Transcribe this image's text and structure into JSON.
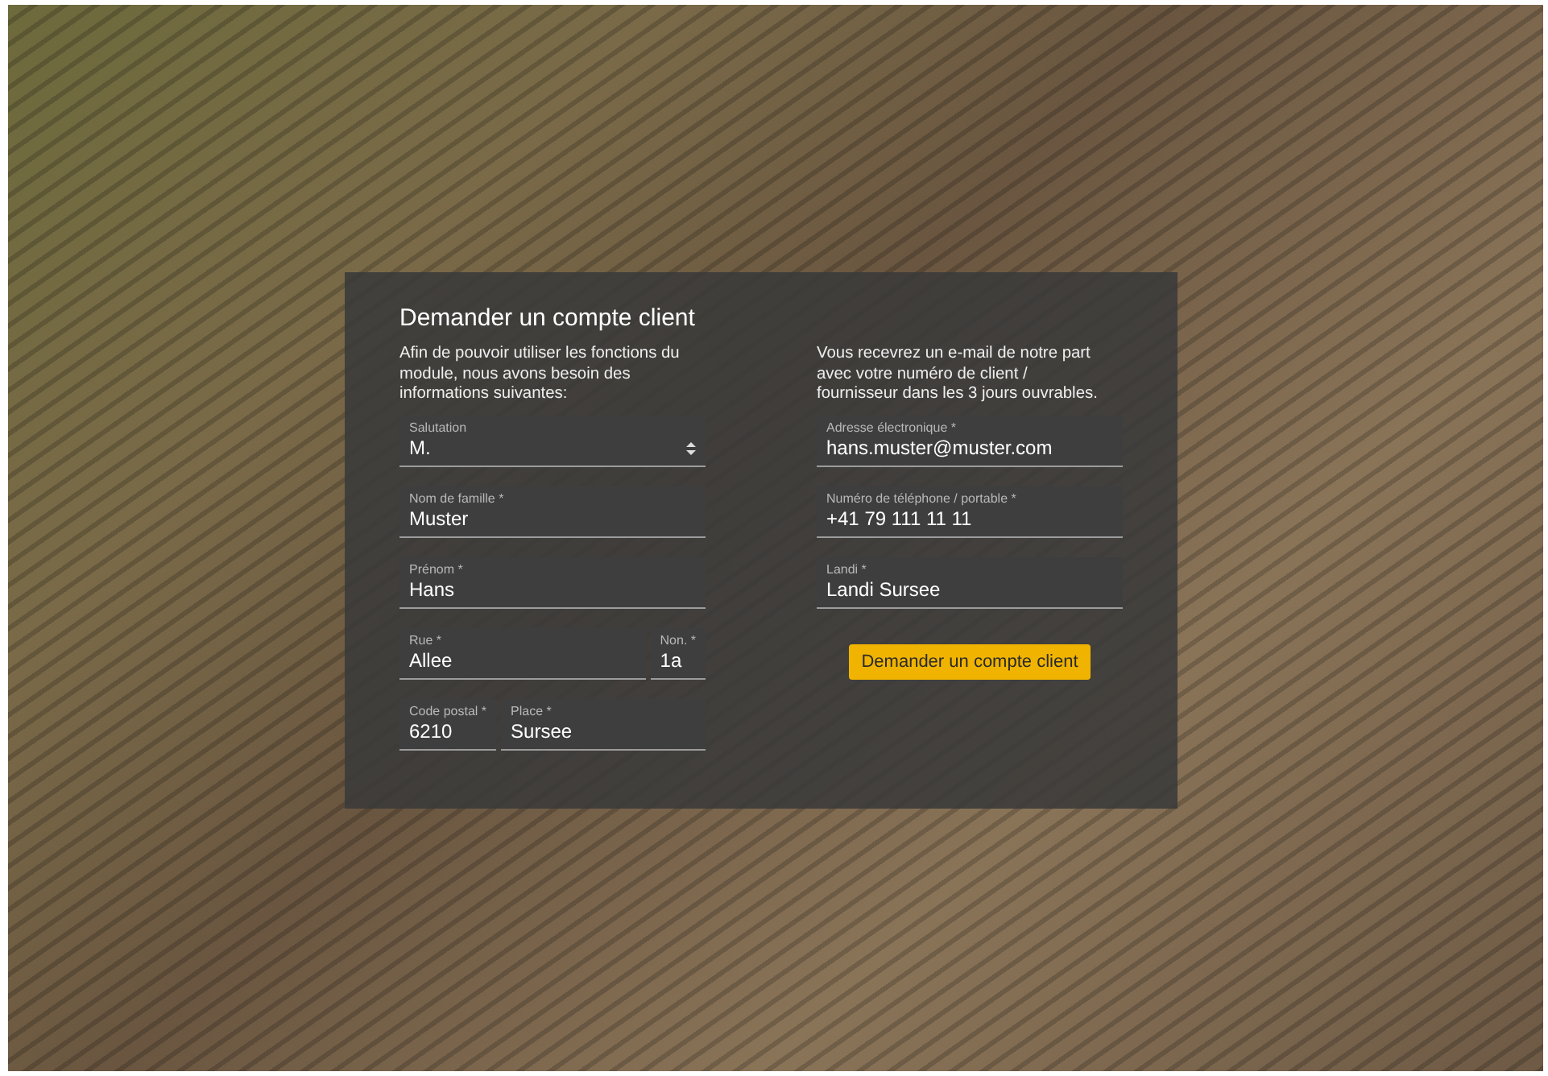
{
  "form": {
    "title": "Demander un compte client",
    "intro": "Afin de pouvoir utiliser les fonctions du module, nous avons besoin des informations suivantes:",
    "notice": "Vous recevrez un e-mail de notre part avec votre numéro de client / fournisseur dans les 3 jours ouvrables.",
    "left_rows": [
      [
        {
          "kind": "select",
          "label": "Salutation",
          "value": "M."
        }
      ],
      [
        {
          "kind": "text",
          "label": "Nom de famille *",
          "value": "Muster"
        }
      ],
      [
        {
          "kind": "text",
          "label": "Prénom *",
          "value": "Hans"
        }
      ],
      [
        {
          "kind": "text",
          "label": "Rue *",
          "value": "Allee"
        },
        {
          "kind": "short",
          "label": "Non. *",
          "value": "1a"
        }
      ],
      [
        {
          "kind": "short",
          "label": "Code postal *",
          "value": "6210"
        },
        {
          "kind": "text",
          "label": "Place *",
          "value": "Sursee"
        }
      ]
    ],
    "right_rows": [
      [
        {
          "kind": "text",
          "label": "Adresse électronique *",
          "value": "hans.muster@muster.com"
        }
      ],
      [
        {
          "kind": "text",
          "label": "Numéro de téléphone / portable *",
          "value": "+41 79 111 11 11"
        }
      ],
      [
        {
          "kind": "text",
          "label": "Landi *",
          "value": "Landi Sursee"
        }
      ]
    ],
    "submit": "Demander un compte client"
  }
}
